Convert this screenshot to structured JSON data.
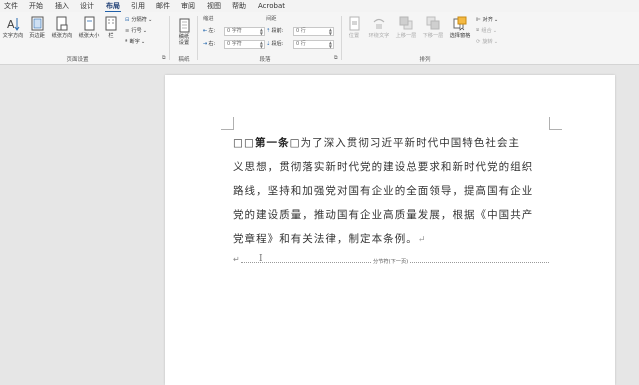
{
  "menu": {
    "tabs": [
      "文件",
      "开始",
      "插入",
      "设计",
      "布局",
      "引用",
      "邮件",
      "审阅",
      "视图",
      "帮助",
      "Acrobat"
    ],
    "active": "布局"
  },
  "ribbon": {
    "page_setup": {
      "text_direction": "文字方向",
      "margins": "页边距",
      "orientation": "纸张方向",
      "size": "纸张大小",
      "columns": "栏",
      "breaks": "分隔符",
      "line_numbers": "行号",
      "hyphenation": "断字",
      "group_label": "页面设置"
    },
    "manuscript": {
      "paper": "稿纸设置",
      "group_label": "稿纸"
    },
    "paragraph": {
      "indent_header": "缩进",
      "spacing_header": "间距",
      "left_label": "左:",
      "right_label": "右:",
      "left_value": "0 字符",
      "right_value": "0 字符",
      "before_label": "段前:",
      "after_label": "段后:",
      "before_value": "0 行",
      "after_value": "0 行",
      "group_label": "段落"
    },
    "arrange": {
      "position": "位置",
      "wrap_text": "环绕文字",
      "bring_forward": "上移一层",
      "send_backward": "下移一层",
      "selection_pane": "选择窗格",
      "align": "对齐",
      "group": "组合",
      "rotate": "旋转",
      "group_label": "排列"
    }
  },
  "document": {
    "heading": "第一条",
    "placeholder_box": "□",
    "line1": "为了深入贯彻习近平新时代中国特色社会主",
    "line2": "义思想，贯彻落实新时代党的建设总要求和新时代党的组织",
    "line3": "路线，坚持和加强党对国有企业的全面领导，提高国有企业",
    "line4": "党的建设质量，推动国有企业高质量发展，根据《中国共产",
    "line5": "党章程》和有关法律，制定本条例。",
    "paragraph_mark": "↵",
    "section_break_label": "分节符(下一页)"
  }
}
